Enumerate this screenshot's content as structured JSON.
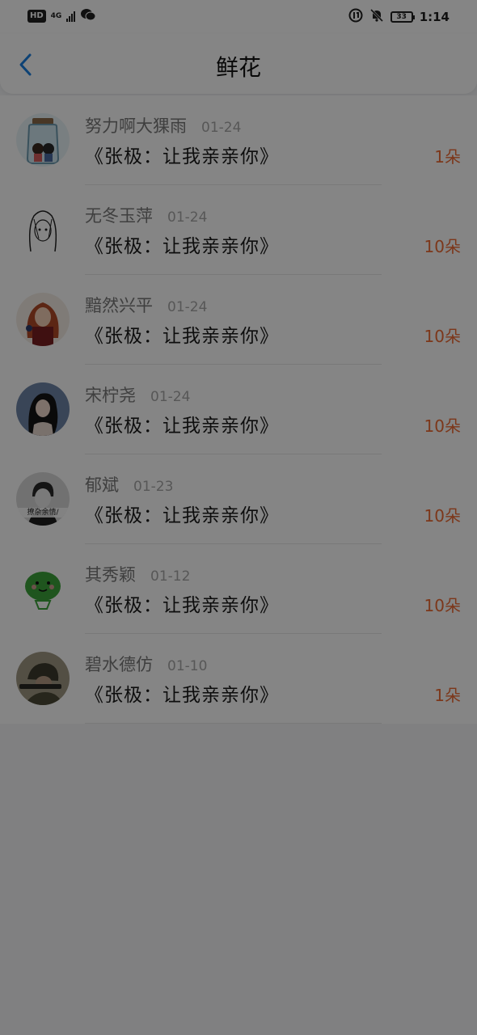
{
  "status_bar": {
    "hd": "HD",
    "network": "4G",
    "battery": "33",
    "time": "1:14",
    "icons": [
      "hd-icon",
      "signal-icon",
      "wechat-icon",
      "data-saver-icon",
      "bell-muted-icon",
      "battery-icon"
    ]
  },
  "header": {
    "title": "鲜花",
    "back_icon": "chevron-left-icon"
  },
  "colors": {
    "accent": "#1a7fe0",
    "count": "#ee6a33",
    "dim_overlay": "rgba(0,0,0,0.48)"
  },
  "flowers": [
    {
      "user": "努力啊大猓雨",
      "date": "01-24",
      "title": "《张极：让我亲亲你》",
      "count": "1朵",
      "avatar": "jar-avatar"
    },
    {
      "user": "无冬玉萍",
      "date": "01-24",
      "title": "《张极：让我亲亲你》",
      "count": "10朵",
      "avatar": "sketch-girl-avatar"
    },
    {
      "user": "黯然兴平",
      "date": "01-24",
      "title": "《张极：让我亲亲你》",
      "count": "10朵",
      "avatar": "redhair-girl-avatar"
    },
    {
      "user": "宋柠尧",
      "date": "01-24",
      "title": "《张极：让我亲亲你》",
      "count": "10朵",
      "avatar": "portrait-woman-avatar"
    },
    {
      "user": "郁斌",
      "date": "01-23",
      "title": "《张极：让我亲亲你》",
      "count": "10朵",
      "avatar": "bw-man-avatar",
      "avatar_caption": "撩杂余情/"
    },
    {
      "user": "其秀颖",
      "date": "01-12",
      "title": "《张极：让我亲亲你》",
      "count": "10朵",
      "avatar": "green-cartoon-avatar"
    },
    {
      "user": "碧水德仿",
      "date": "01-10",
      "title": "《张极：让我亲亲你》",
      "count": "1朵",
      "avatar": "soldier-avatar"
    }
  ]
}
